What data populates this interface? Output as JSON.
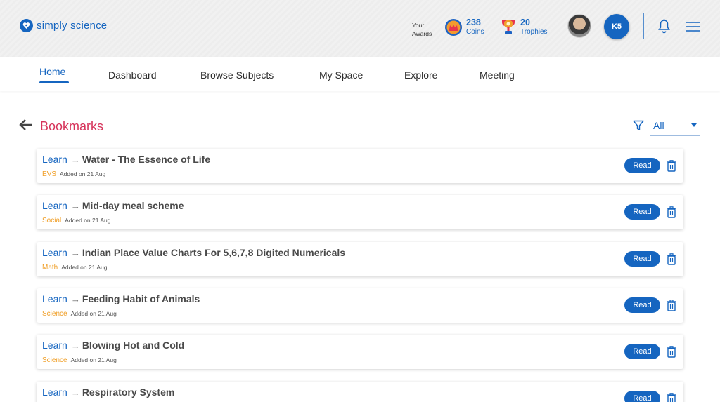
{
  "brand": {
    "name": "simply science",
    "color": "#1565c0"
  },
  "header": {
    "awards_label_1": "Your",
    "awards_label_2": "Awards",
    "coins": {
      "value": "238",
      "label": "Coins"
    },
    "trophies": {
      "value": "20",
      "label": "Trophies"
    },
    "user_initials": "K5"
  },
  "nav": [
    {
      "label": "Home",
      "active": true
    },
    {
      "label": "Dashboard"
    },
    {
      "label": "Browse Subjects"
    },
    {
      "label": "My Space"
    },
    {
      "label": "Explore"
    },
    {
      "label": "Meeting"
    }
  ],
  "page": {
    "title": "Bookmarks",
    "filter": {
      "selected": "All"
    }
  },
  "bookmarks": [
    {
      "type": "Learn",
      "arrow": "→",
      "topic": "Water - The Essence of Life",
      "subject": "EVS",
      "added": "Added on 21 Aug",
      "action": "Read"
    },
    {
      "type": "Learn",
      "arrow": "→",
      "topic": "Mid-day meal scheme",
      "subject": "Social",
      "added": "Added on 21 Aug",
      "action": "Read"
    },
    {
      "type": "Learn",
      "arrow": "→",
      "topic": "Indian Place Value Charts For 5,6,7,8 Digited Numericals",
      "subject": "Math",
      "added": "Added on 21 Aug",
      "action": "Read"
    },
    {
      "type": "Learn",
      "arrow": "→",
      "topic": "Feeding Habit of Animals",
      "subject": "Science",
      "added": "Added on 21 Aug",
      "action": "Read"
    },
    {
      "type": "Learn",
      "arrow": "→",
      "topic": "Blowing Hot and Cold",
      "subject": "Science",
      "added": "Added on 21 Aug",
      "action": "Read"
    },
    {
      "type": "Learn",
      "arrow": "→",
      "topic": "Respiratory System",
      "subject": "",
      "added": "",
      "action": "Read"
    }
  ],
  "colors": {
    "accent": "#1565c0",
    "title": "#d6335a",
    "subject": "#f0a02a"
  },
  "icons": [
    "logo-icon",
    "coins-icon",
    "trophy-icon",
    "bell-icon",
    "menu-icon",
    "back-arrow-icon",
    "filter-icon",
    "trash-icon"
  ]
}
